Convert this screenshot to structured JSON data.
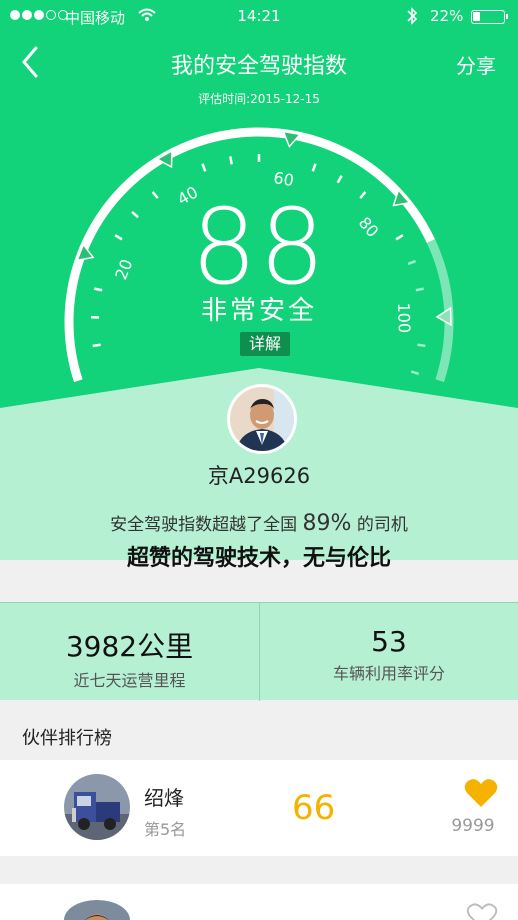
{
  "status_bar": {
    "carrier": "中国移动",
    "time": "14:21",
    "battery_text": "22%",
    "battery_level": 0.22
  },
  "nav": {
    "back_icon": "chevron-left-icon",
    "title": "我的安全驾驶指数",
    "share_label": "分享"
  },
  "assess_date": "评估时间:2015-12-15",
  "gauge": {
    "ticks": [
      "20",
      "40",
      "60",
      "80",
      "100"
    ],
    "score": "88",
    "level": "非常安全",
    "detail_label": "详解"
  },
  "driver": {
    "plate": "京A29626",
    "summary_prefix": "安全驾驶指数超越了全国",
    "summary_percent": "89%",
    "summary_suffix": "的司机",
    "comment": "超赞的驾驶技术，无与伦比"
  },
  "stats": [
    {
      "value": "3982公里",
      "label": "近七天运营里程"
    },
    {
      "value": "53",
      "label": "车辆利用率评分"
    }
  ],
  "ranking": {
    "title": "伙伴排行榜",
    "items": [
      {
        "name": "绍烽",
        "position": "第5名",
        "score": "66",
        "likes": "9999",
        "liked": true
      }
    ]
  },
  "colors": {
    "accent": "#12d27a",
    "light_accent": "#b6f0d3",
    "score_color": "#f5b300"
  }
}
